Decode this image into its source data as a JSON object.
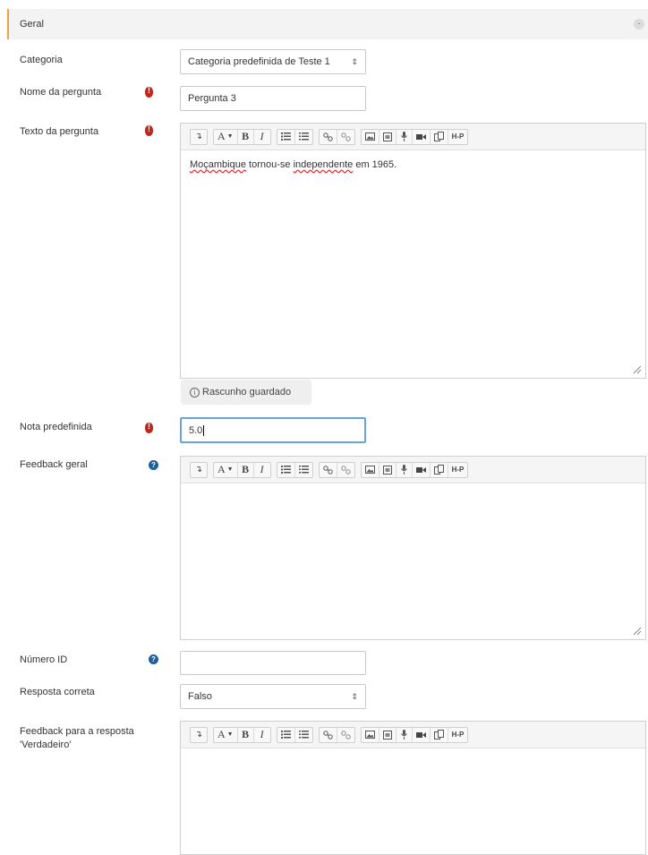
{
  "section": {
    "title": "Geral",
    "collapse_symbol": "-"
  },
  "labels": {
    "categoria": "Categoria",
    "nome": "Nome da pergunta",
    "texto": "Texto da pergunta",
    "nota": "Nota predefinida",
    "feedback_geral": "Feedback geral",
    "numero_id": "Número ID",
    "resposta_correta": "Resposta correta",
    "feedback_verdadeiro_l1": "Feedback para a resposta",
    "feedback_verdadeiro_l2": "'Verdadeiro'"
  },
  "fields": {
    "categoria_value": "Categoria predefinida de Teste 1",
    "nome_value": "Pergunta 3",
    "nota_value": "5.0",
    "numero_id_value": "",
    "resposta_correta_value": "Falso"
  },
  "question_text": {
    "word1": "Moçambique",
    "word2": " tornou-se ",
    "word3": "independente",
    "word4": " em 1965."
  },
  "draft_status": "Rascunho guardado",
  "toolbar": {
    "para_symbol": "↴",
    "font_color": "A",
    "bold": "B",
    "italic": "I",
    "h5p": "H-P"
  },
  "icons": {
    "required": "exclamation-circle-icon",
    "help": "question-circle-icon",
    "info": "info-icon",
    "select_arrow": "⇕"
  },
  "colors": {
    "required": "#c0281f",
    "help": "#1f5f9e",
    "focus": "#6aa2dc",
    "section_accent": "#f0a040"
  }
}
